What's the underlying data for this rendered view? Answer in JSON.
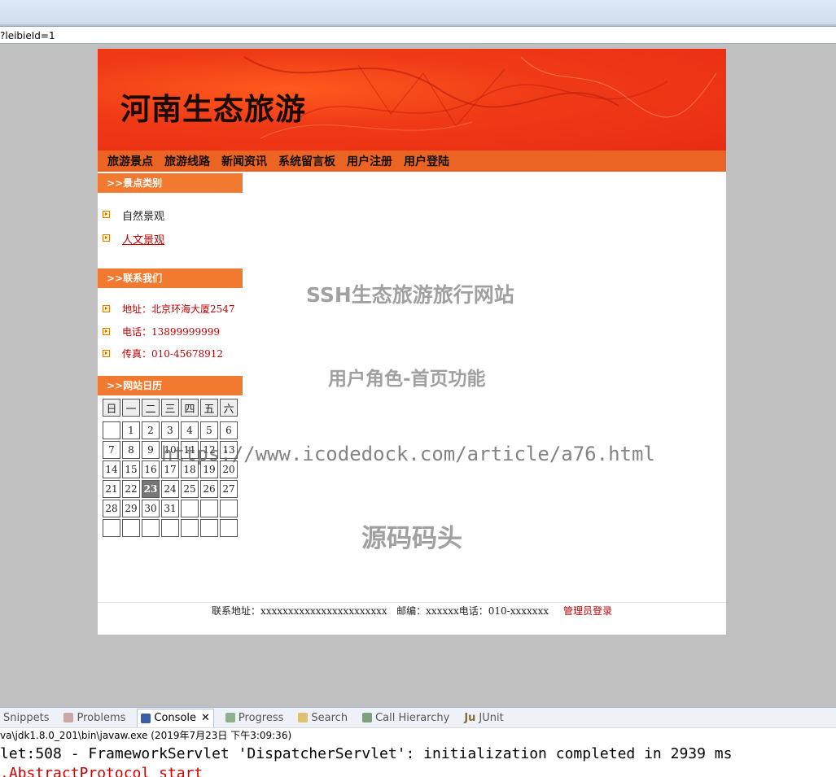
{
  "browser": {
    "url": "?leibieId=1"
  },
  "site": {
    "title": "河南生态旅游",
    "nav": [
      "旅游景点",
      "旅游线路",
      "新闻资讯",
      "系统留言板",
      "用户注册",
      "用户登陆"
    ],
    "categories": {
      "heading": ">>景点类别",
      "items": [
        "自然景观",
        "人文景观"
      ]
    },
    "contact": {
      "heading": ">>联系我们",
      "address": "地址：北京环海大厦2547",
      "phone": "电话：13899999999",
      "fax": "传真：010-45678912"
    },
    "calendar": {
      "heading": ">>网站日历",
      "weekdays": [
        "日",
        "一",
        "二",
        "三",
        "四",
        "五",
        "六"
      ],
      "weeks": [
        [
          "",
          "1",
          "2",
          "3",
          "4",
          "5",
          "6"
        ],
        [
          "7",
          "8",
          "9",
          "10",
          "11",
          "12",
          "13"
        ],
        [
          "14",
          "15",
          "16",
          "17",
          "18",
          "19",
          "20"
        ],
        [
          "21",
          "22",
          "23",
          "24",
          "25",
          "26",
          "27"
        ],
        [
          "28",
          "29",
          "30",
          "31",
          "",
          "",
          ""
        ],
        [
          "",
          "",
          "",
          "",
          "",
          "",
          ""
        ]
      ],
      "today": "23"
    },
    "footer": {
      "address": "联系地址：xxxxxxxxxxxxxxxxxxxxxxx",
      "postcode": "邮编：xxxxxx",
      "phone": "电话：010-xxxxxxx",
      "admin_link": "管理员登录"
    }
  },
  "watermark": {
    "line1": "SSH生态旅游旅行网站",
    "line2": "用户角色-首页功能",
    "line3": "https://www.icodedock.com/article/a76.html",
    "line4": "源码码头"
  },
  "ide": {
    "tabs": [
      "Snippets",
      "Problems",
      "Console",
      "Progress",
      "Search",
      "Call Hierarchy",
      "JUnit"
    ],
    "active_tab": "Console",
    "process": "va\\jdk1.8.0_201\\bin\\javaw.exe (2019年7月23日 下午3:09:36)",
    "console_lines": [
      "let:508 - FrameworkServlet 'DispatcherServlet': initialization completed in 2939 ms",
      ".AbstractProtocol start"
    ]
  }
}
